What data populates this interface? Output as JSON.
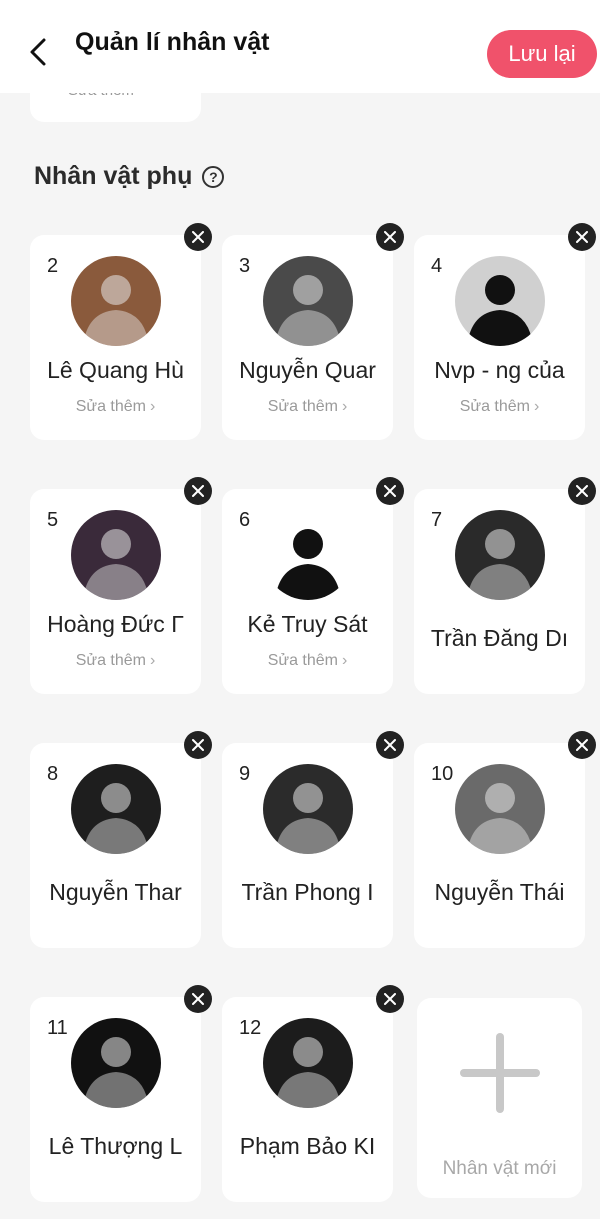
{
  "header": {
    "title": "Quản lí nhân vật",
    "save_label": "Lưu lại",
    "back_icon": "chevron-left-icon"
  },
  "peek_card": {
    "edit_label": "Sửa thêm"
  },
  "section": {
    "title": "Nhân vật phụ",
    "help_icon": "question-circle-icon"
  },
  "characters": [
    {
      "num": "2",
      "name": "Lê Quang Hù",
      "edit_label": "Sửa thêm",
      "avatar_color": "#8a5a3c"
    },
    {
      "num": "3",
      "name": "Nguyễn Quar",
      "edit_label": "Sửa thêm",
      "avatar_color": "#4a4a4a"
    },
    {
      "num": "4",
      "name": "Nvp - ng của",
      "edit_label": "Sửa thêm",
      "avatar_color": "#d0d0d0"
    },
    {
      "num": "5",
      "name": "Hoàng Đức Γ",
      "edit_label": "Sửa thêm",
      "avatar_color": "#3a2a3a"
    },
    {
      "num": "6",
      "name": "Kẻ Truy Sát",
      "edit_label": "Sửa thêm",
      "avatar_color": "#ffffff"
    },
    {
      "num": "7",
      "name": "Trần Đăng Dı",
      "edit_label": "",
      "avatar_color": "#2a2a2a"
    },
    {
      "num": "8",
      "name": "Nguyễn Thar",
      "edit_label": "",
      "avatar_color": "#1e1e1e"
    },
    {
      "num": "9",
      "name": "Trần Phong I",
      "edit_label": "",
      "avatar_color": "#2b2b2b"
    },
    {
      "num": "10",
      "name": "Nguyễn Thái",
      "edit_label": "",
      "avatar_color": "#6a6a6a"
    },
    {
      "num": "11",
      "name": "Lê Thượng L",
      "edit_label": "",
      "avatar_color": "#111111"
    },
    {
      "num": "12",
      "name": "Phạm Bảo KI",
      "edit_label": "",
      "avatar_color": "#1c1c1c"
    }
  ],
  "add_card": {
    "label": "Nhân vật mới",
    "icon": "plus-icon"
  },
  "colors": {
    "accent": "#f0526b",
    "background": "#f5f5f5",
    "card": "#ffffff"
  }
}
